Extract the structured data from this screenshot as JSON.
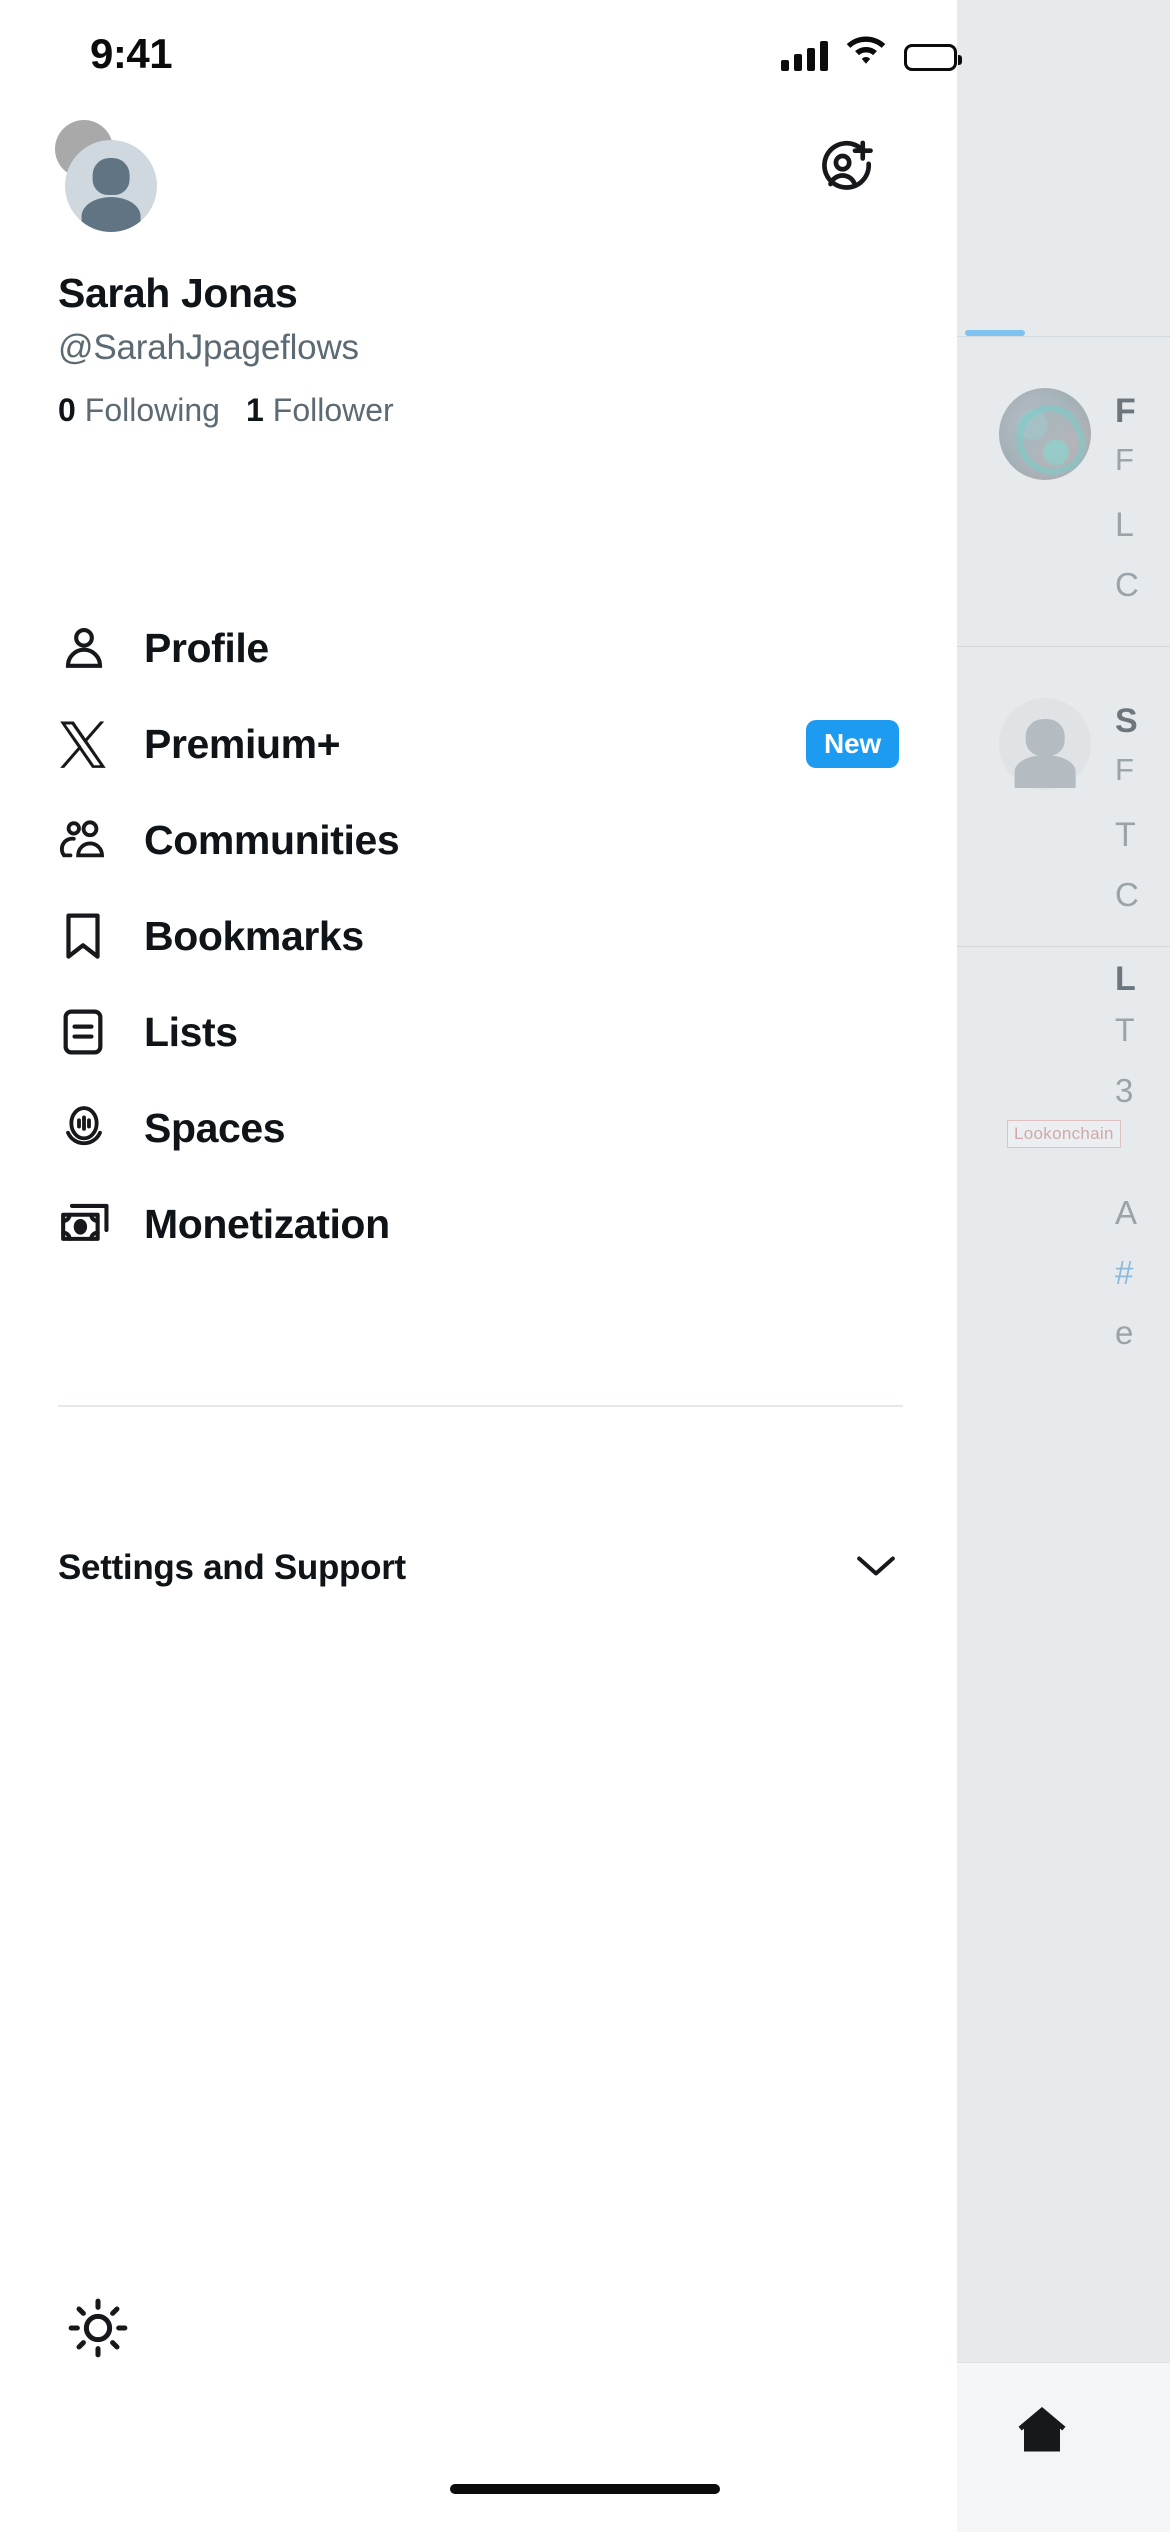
{
  "status_bar": {
    "time": "9:41",
    "cellular_icon": "signal-bars-icon",
    "wifi_icon": "wifi-icon",
    "battery_icon": "battery-full-icon"
  },
  "profile": {
    "display_name": "Sarah Jonas",
    "handle": "@SarahJpageflows",
    "following_count": "0",
    "following_label": "Following",
    "followers_count": "1",
    "followers_label": "Follower",
    "avatar_icon": "avatar",
    "secondary_account_icon": "secondary-avatar",
    "add_account_icon": "add-account-icon"
  },
  "nav": {
    "items": [
      {
        "label": "Profile",
        "icon": "person-icon",
        "badge": null
      },
      {
        "label": "Premium+",
        "icon": "x-logo-icon",
        "badge": "New"
      },
      {
        "label": "Communities",
        "icon": "people-icon",
        "badge": null
      },
      {
        "label": "Bookmarks",
        "icon": "bookmark-icon",
        "badge": null
      },
      {
        "label": "Lists",
        "icon": "lists-icon",
        "badge": null
      },
      {
        "label": "Spaces",
        "icon": "spaces-icon",
        "badge": null
      },
      {
        "label": "Monetization",
        "icon": "money-icon",
        "badge": null
      }
    ]
  },
  "settings": {
    "label": "Settings and Support",
    "chevron_icon": "chevron-down-icon"
  },
  "appearance": {
    "icon": "brightness-sun-icon"
  },
  "colors": {
    "accent_blue": "#1D9BF0",
    "text_primary": "#0F1419",
    "text_secondary": "#5C6A73",
    "divider": "#E6E9EA",
    "backdrop": "#E6EAEC"
  },
  "backdrop_timeline": {
    "watermark": "Lookonchain",
    "posts": [
      {
        "name_fragment": "F",
        "handle_fragment": "F",
        "line1": "L",
        "line2": "C",
        "avatar": "photo-avatar"
      },
      {
        "name_fragment": "S",
        "handle_fragment": "F",
        "line1": "T",
        "line2": "C",
        "avatar": "generic-avatar"
      },
      {
        "name_fragment": "L",
        "handle_fragment": "T",
        "line1": "3",
        "line2": "A",
        "line3": "#",
        "line4": "e",
        "avatar": "watermark-avatar"
      }
    ],
    "home_tab_icon": "home-icon"
  }
}
